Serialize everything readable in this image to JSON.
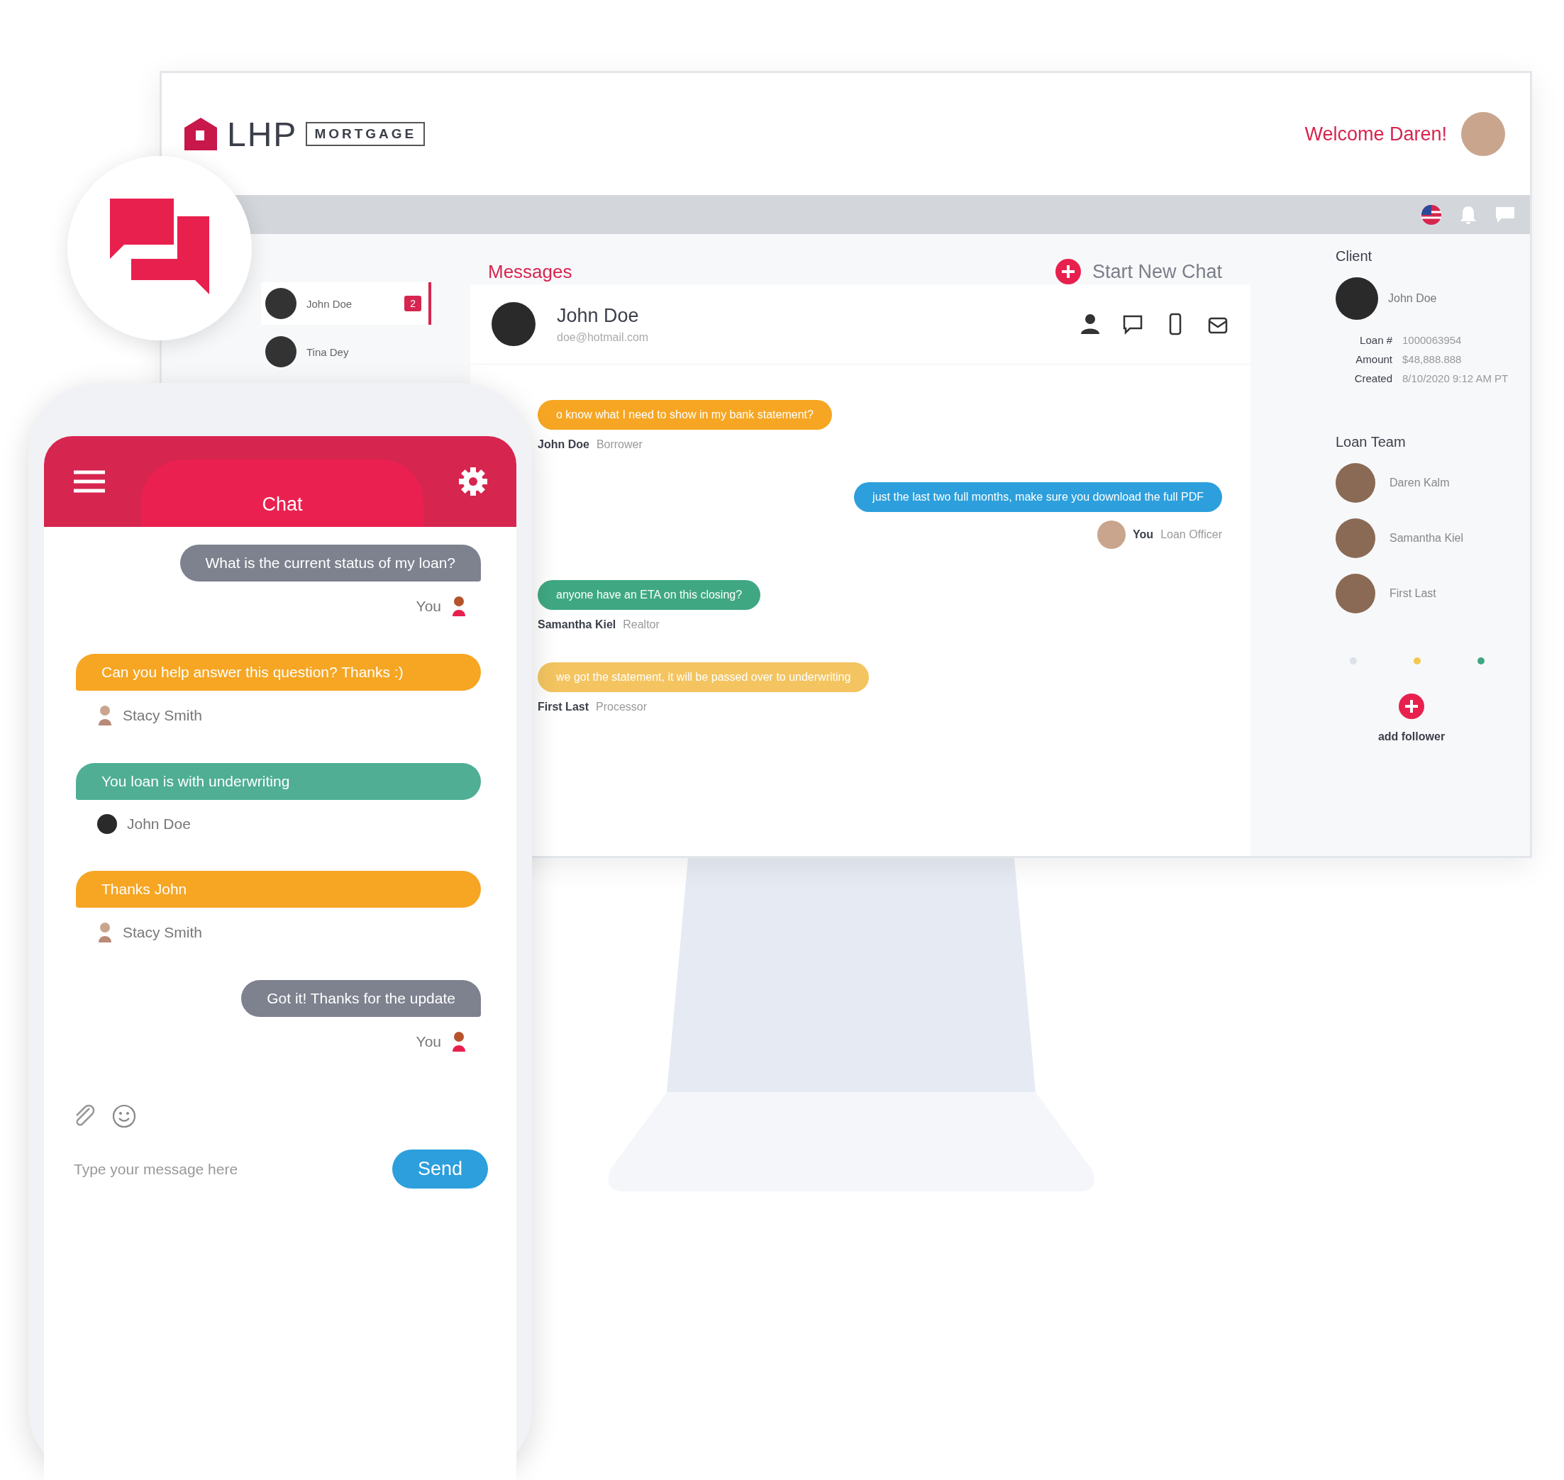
{
  "desktop": {
    "logo": {
      "name": "LHP",
      "tag": "MORTGAGE"
    },
    "welcome": "Welcome Daren!",
    "conversations": [
      {
        "name": "John Doe",
        "unread": "2",
        "selected": true
      },
      {
        "name": "Tina Dey",
        "selected": false
      }
    ],
    "messages_title": "Messages",
    "new_chat": "Start New Chat",
    "contact": {
      "name": "John Doe",
      "email": "doe@hotmail.com"
    },
    "thread": [
      {
        "kind": "received",
        "color": "#f6a623",
        "text": "o know what I need to show in my bank statement?",
        "sender": "John Doe",
        "role": "Borrower"
      },
      {
        "kind": "sent",
        "color": "#2c9fdc",
        "text": "just the last two full months, make sure you download the full PDF",
        "sender": "You",
        "role": "Loan Officer"
      },
      {
        "kind": "received",
        "color": "#3fa882",
        "text": "anyone have an ETA on this closing?",
        "sender": "Samantha Kiel",
        "role": "Realtor"
      },
      {
        "kind": "received",
        "color": "#f3c460",
        "text": "we got the statement, it will be passed over to underwriting",
        "sender": "First Last",
        "role": "Processor"
      }
    ],
    "client": {
      "heading": "Client",
      "name": "John Doe",
      "fields": [
        {
          "label": "Loan #",
          "value": "1000063954"
        },
        {
          "label": "Amount",
          "value": "$48,888.888"
        },
        {
          "label": "Created",
          "value": "8/10/2020 9:12 AM PT"
        }
      ]
    },
    "team": {
      "heading": "Loan Team",
      "members": [
        "Daren Kalm",
        "Samantha Kiel",
        "First Last"
      ]
    },
    "status_dots": [
      {
        "color": "#dde2e8"
      },
      {
        "color": "#f2c94c"
      },
      {
        "color": "#3fa882"
      }
    ],
    "add_follower": "add follower"
  },
  "phone": {
    "title": "Chat",
    "messages": [
      {
        "kind": "sent",
        "color": "#7e828f",
        "text": "What is the current status of my loan?",
        "sender": "You"
      },
      {
        "kind": "received",
        "color": "#f6a623",
        "text": "Can you help answer this question? Thanks :)",
        "sender": "Stacy Smith"
      },
      {
        "kind": "received",
        "color": "#4fae94",
        "text": "You loan is with underwriting",
        "sender": "John Doe"
      },
      {
        "kind": "received",
        "color": "#f6a623",
        "text": "Thanks John",
        "sender": "Stacy Smith"
      },
      {
        "kind": "sent",
        "color": "#7e828f",
        "text": "Got it! Thanks for the update",
        "sender": "You"
      }
    ],
    "placeholder": "Type your message here",
    "send": "Send"
  }
}
